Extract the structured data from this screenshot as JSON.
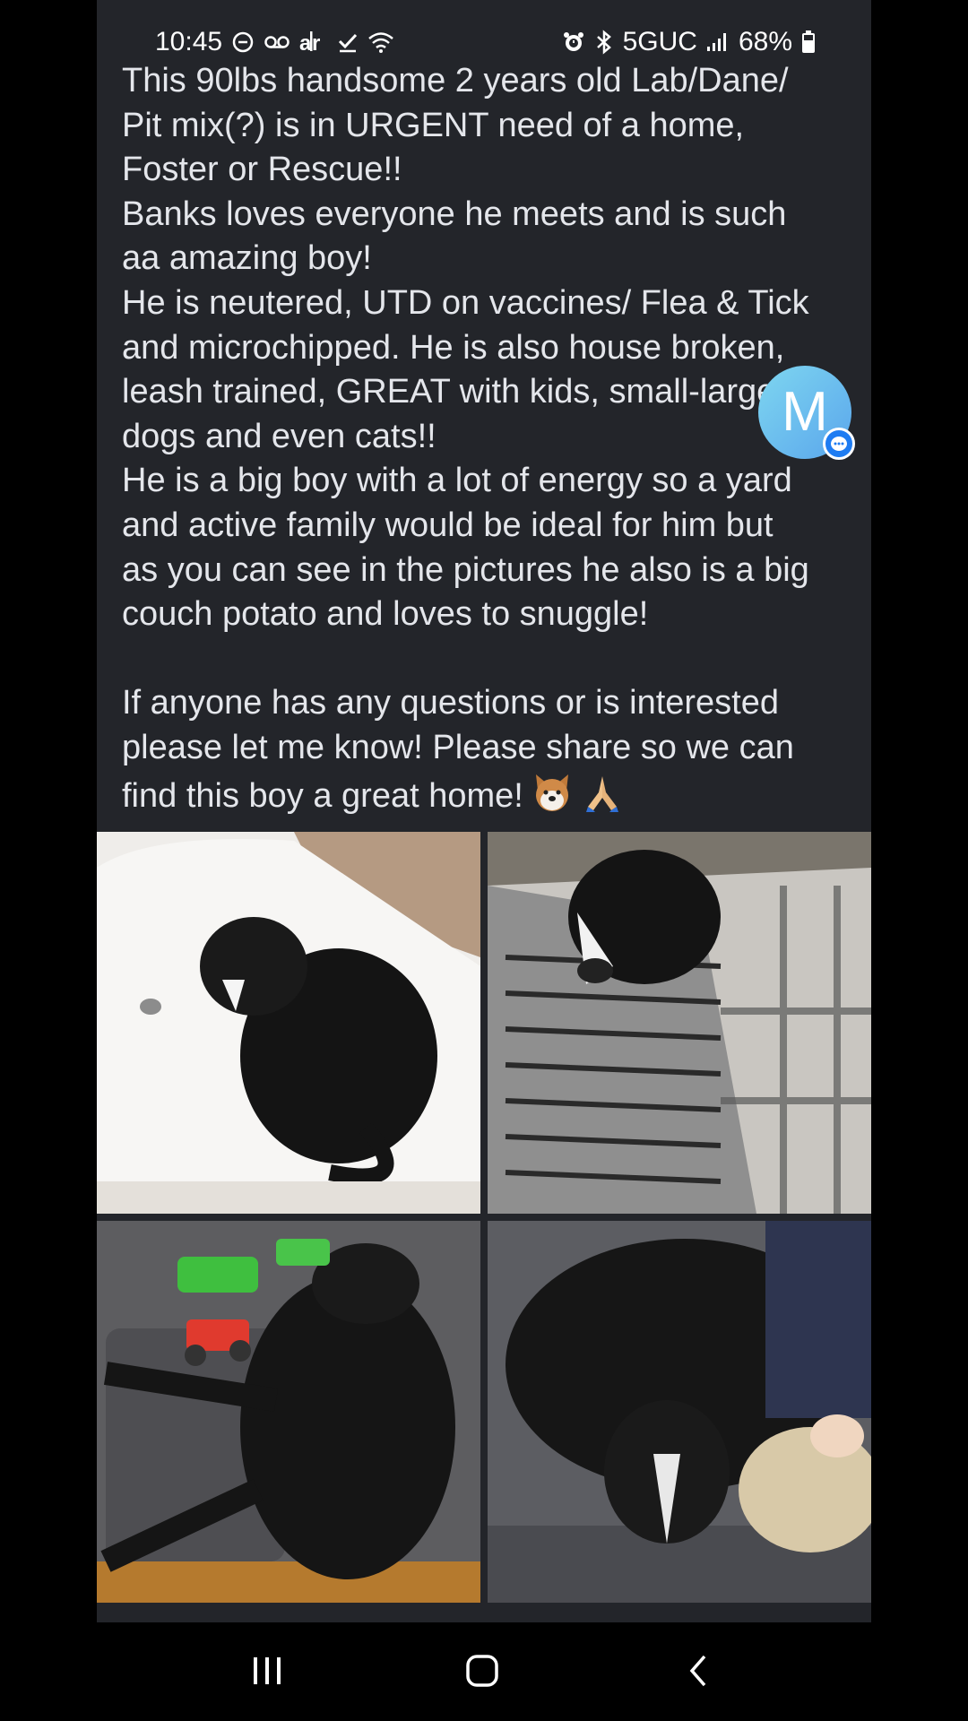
{
  "status_bar": {
    "time": "10:45",
    "network": "5GUC",
    "battery": "68%",
    "left_icons": [
      "do-not-disturb-icon",
      "voicemail-icon",
      "airtel-icon",
      "check-icon",
      "wifi-icon"
    ],
    "right_icons": [
      "alarm-icon",
      "bluetooth-icon",
      "signal-icon",
      "battery-icon"
    ]
  },
  "post": {
    "text": "This 90lbs handsome 2 years old Lab/Dane/\nPit mix(?) is in URGENT need of a home,\nFoster or Rescue!!\nBanks loves everyone he meets and is such\naa amazing boy!\nHe is neutered, UTD on vaccines/ Flea & Tick\nand microchipped. He is also house broken,\nleash trained, GREAT with kids, small-large\ndogs and even cats!!\nHe is a big boy with a lot of energy so a yard\nand active family would be ideal for him but\nas you can see in the pictures he also is a big\ncouch potato and loves to snuggle!\n\nIf anyone has any questions or is interested\nplease let me know! Please share so we can\nfind this boy a great home!",
    "emojis": [
      "dog-face-emoji",
      "folded-hands-emoji"
    ]
  },
  "chat_head": {
    "letter": "M"
  },
  "photos": [
    {
      "name": "dog-in-bathtub"
    },
    {
      "name": "dog-on-blanket"
    },
    {
      "name": "dog-on-couch-with-toys"
    },
    {
      "name": "dog-snuggling-child"
    }
  ],
  "nav_bar": {
    "buttons": [
      "recents",
      "home",
      "back"
    ]
  },
  "colors": {
    "background": "#000000",
    "panel": "#23252a",
    "text": "#e4e6eb",
    "chat_head": "#6cbdee",
    "badge": "#1e7cf2"
  }
}
